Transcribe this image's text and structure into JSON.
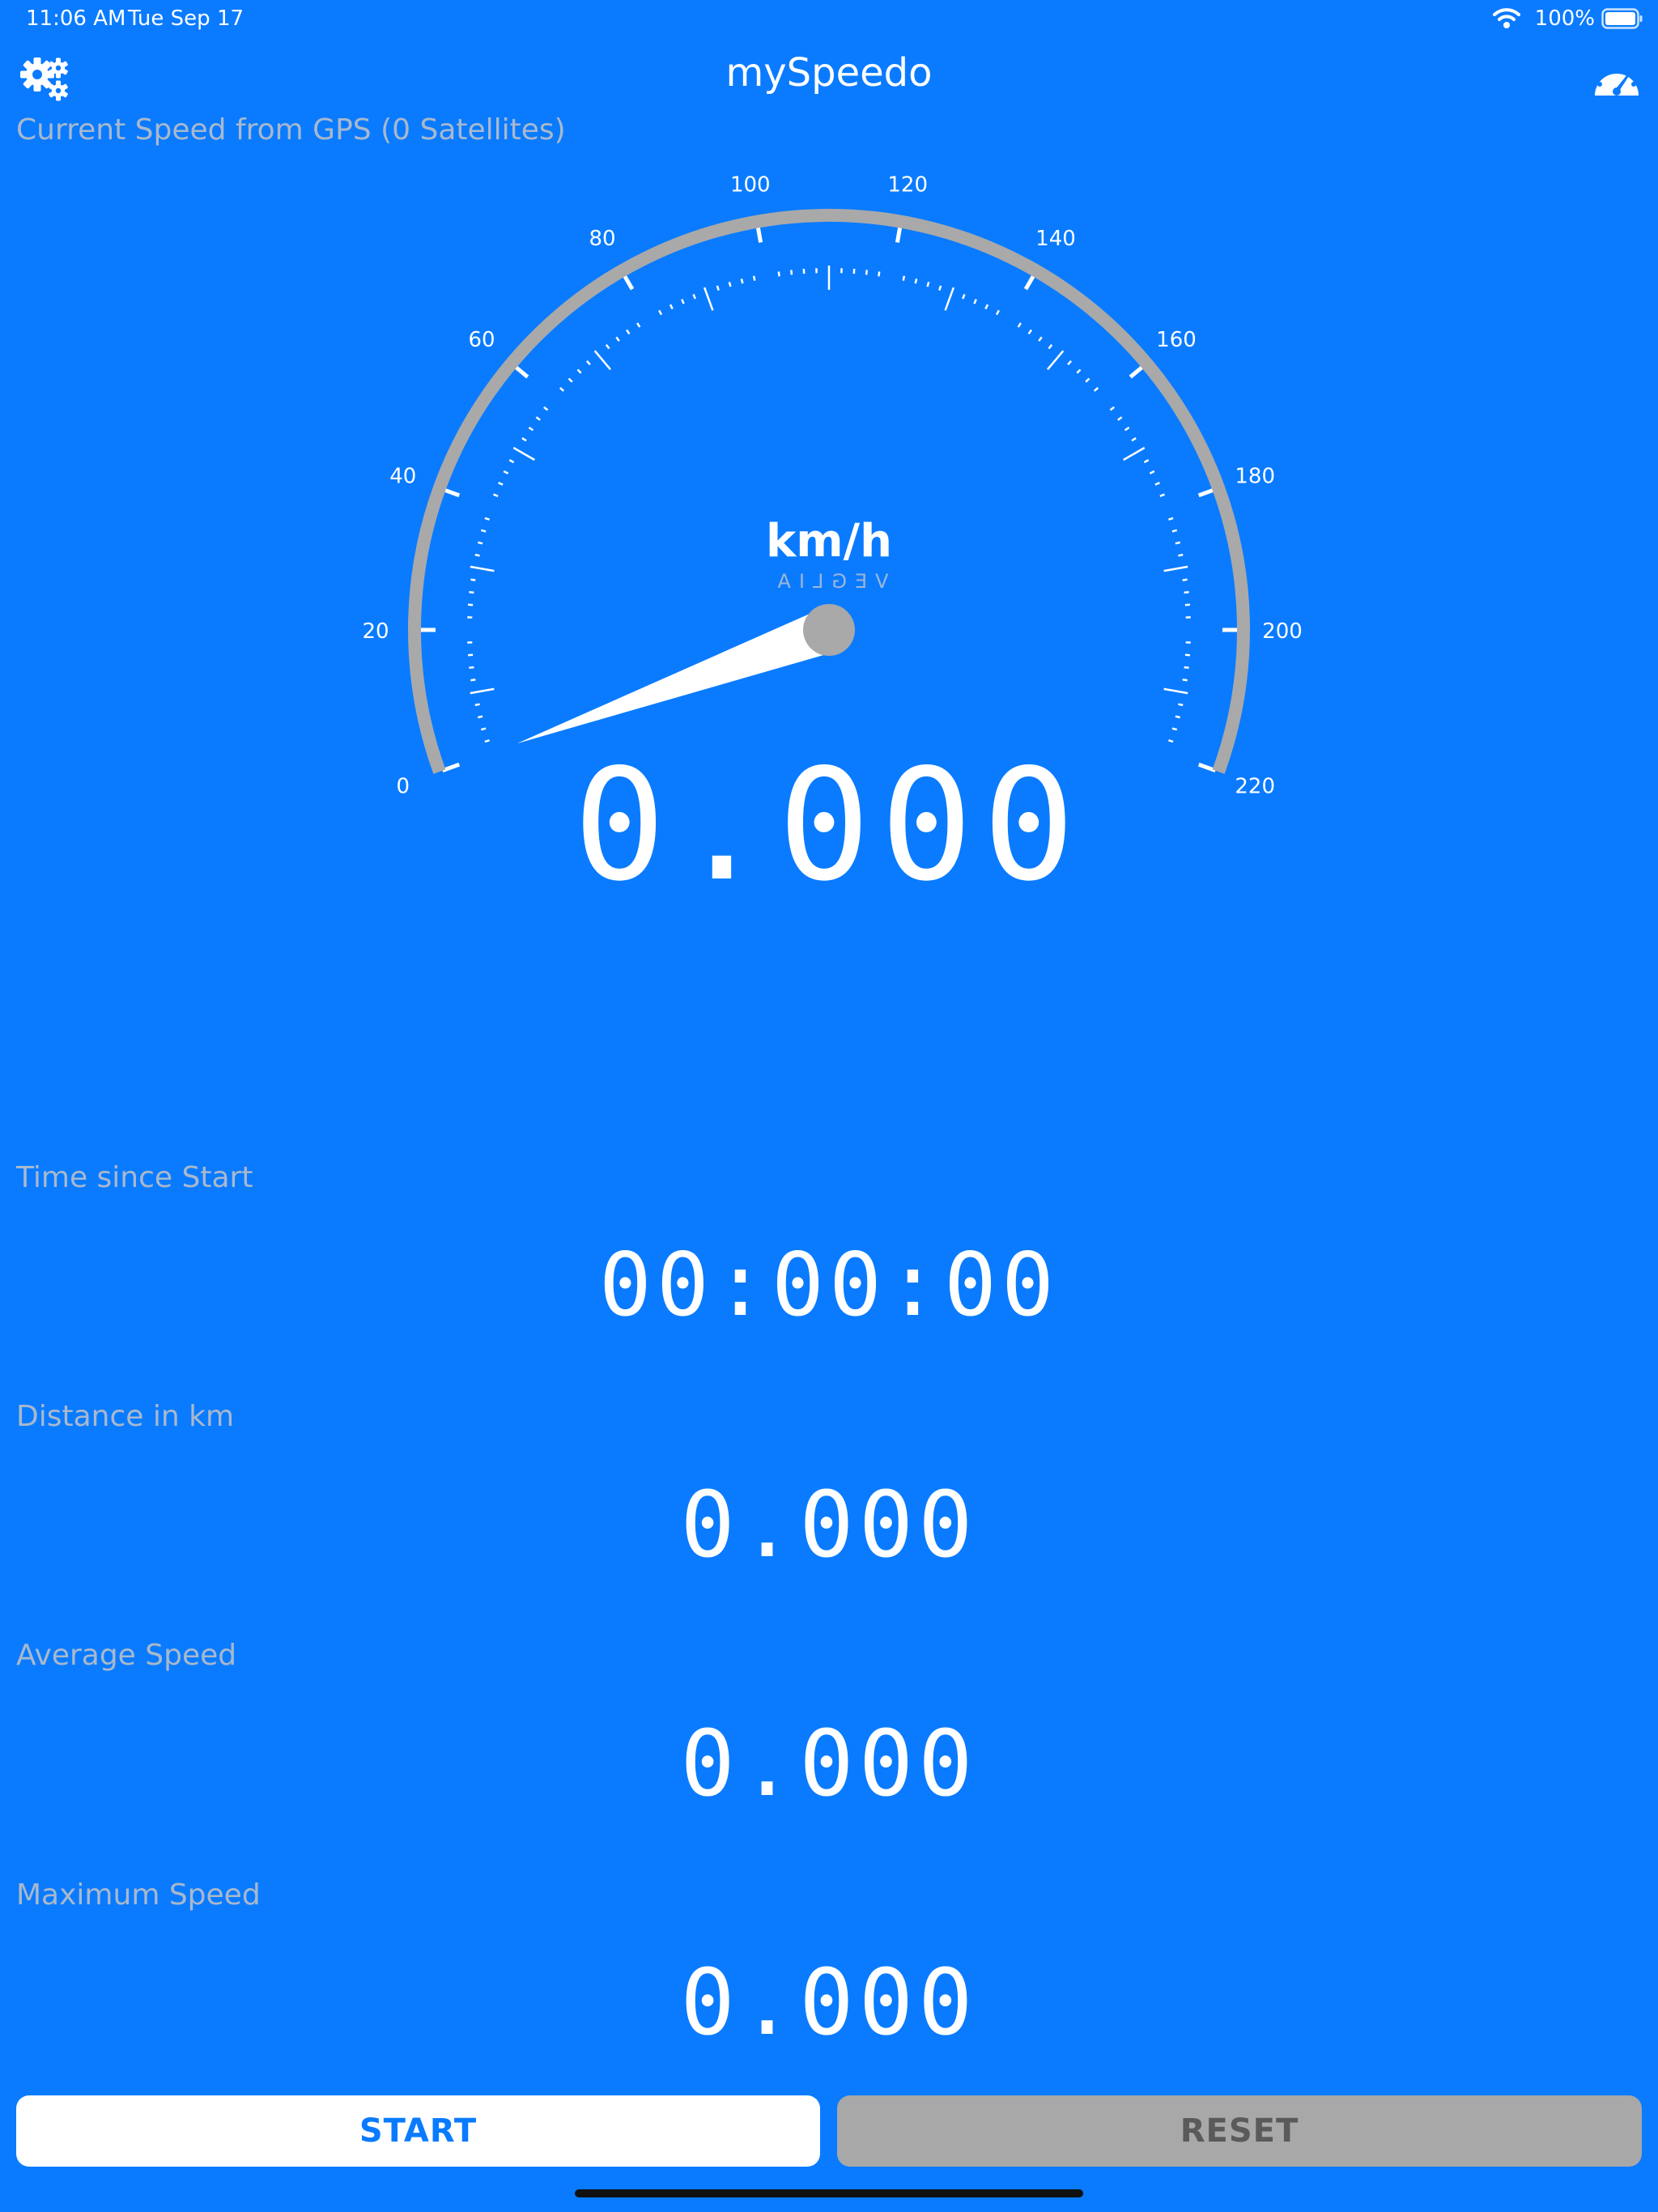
{
  "status_bar": {
    "time": "11:06 AM",
    "date": "Tue Sep 17",
    "battery_percent": "100%"
  },
  "nav": {
    "title": "mySpeedo",
    "left_icon": "gears-icon",
    "right_icon": "gauge-icon"
  },
  "speed": {
    "label": "Current Speed from GPS (0 Satellites)",
    "value": "0.000",
    "unit": "km/h",
    "brand": "VEGLIA",
    "scale_labels": [
      "0",
      "20",
      "40",
      "60",
      "80",
      "100",
      "120",
      "140",
      "160",
      "180",
      "200",
      "220"
    ],
    "min": 0,
    "max": 220,
    "current": 0
  },
  "time": {
    "label": "Time since Start",
    "value": "00:00:00"
  },
  "distance": {
    "label": "Distance in km",
    "value": "0.000"
  },
  "average": {
    "label": "Average Speed",
    "value": "0.000"
  },
  "maximum": {
    "label": "Maximum Speed",
    "value": "0.000"
  },
  "buttons": {
    "start": "START",
    "reset": "RESET"
  },
  "colors": {
    "background": "#0a7bff",
    "gauge_arc": "#a9a9a9",
    "label": "#a9b8cc",
    "reset_button": "#a8a8a8"
  }
}
